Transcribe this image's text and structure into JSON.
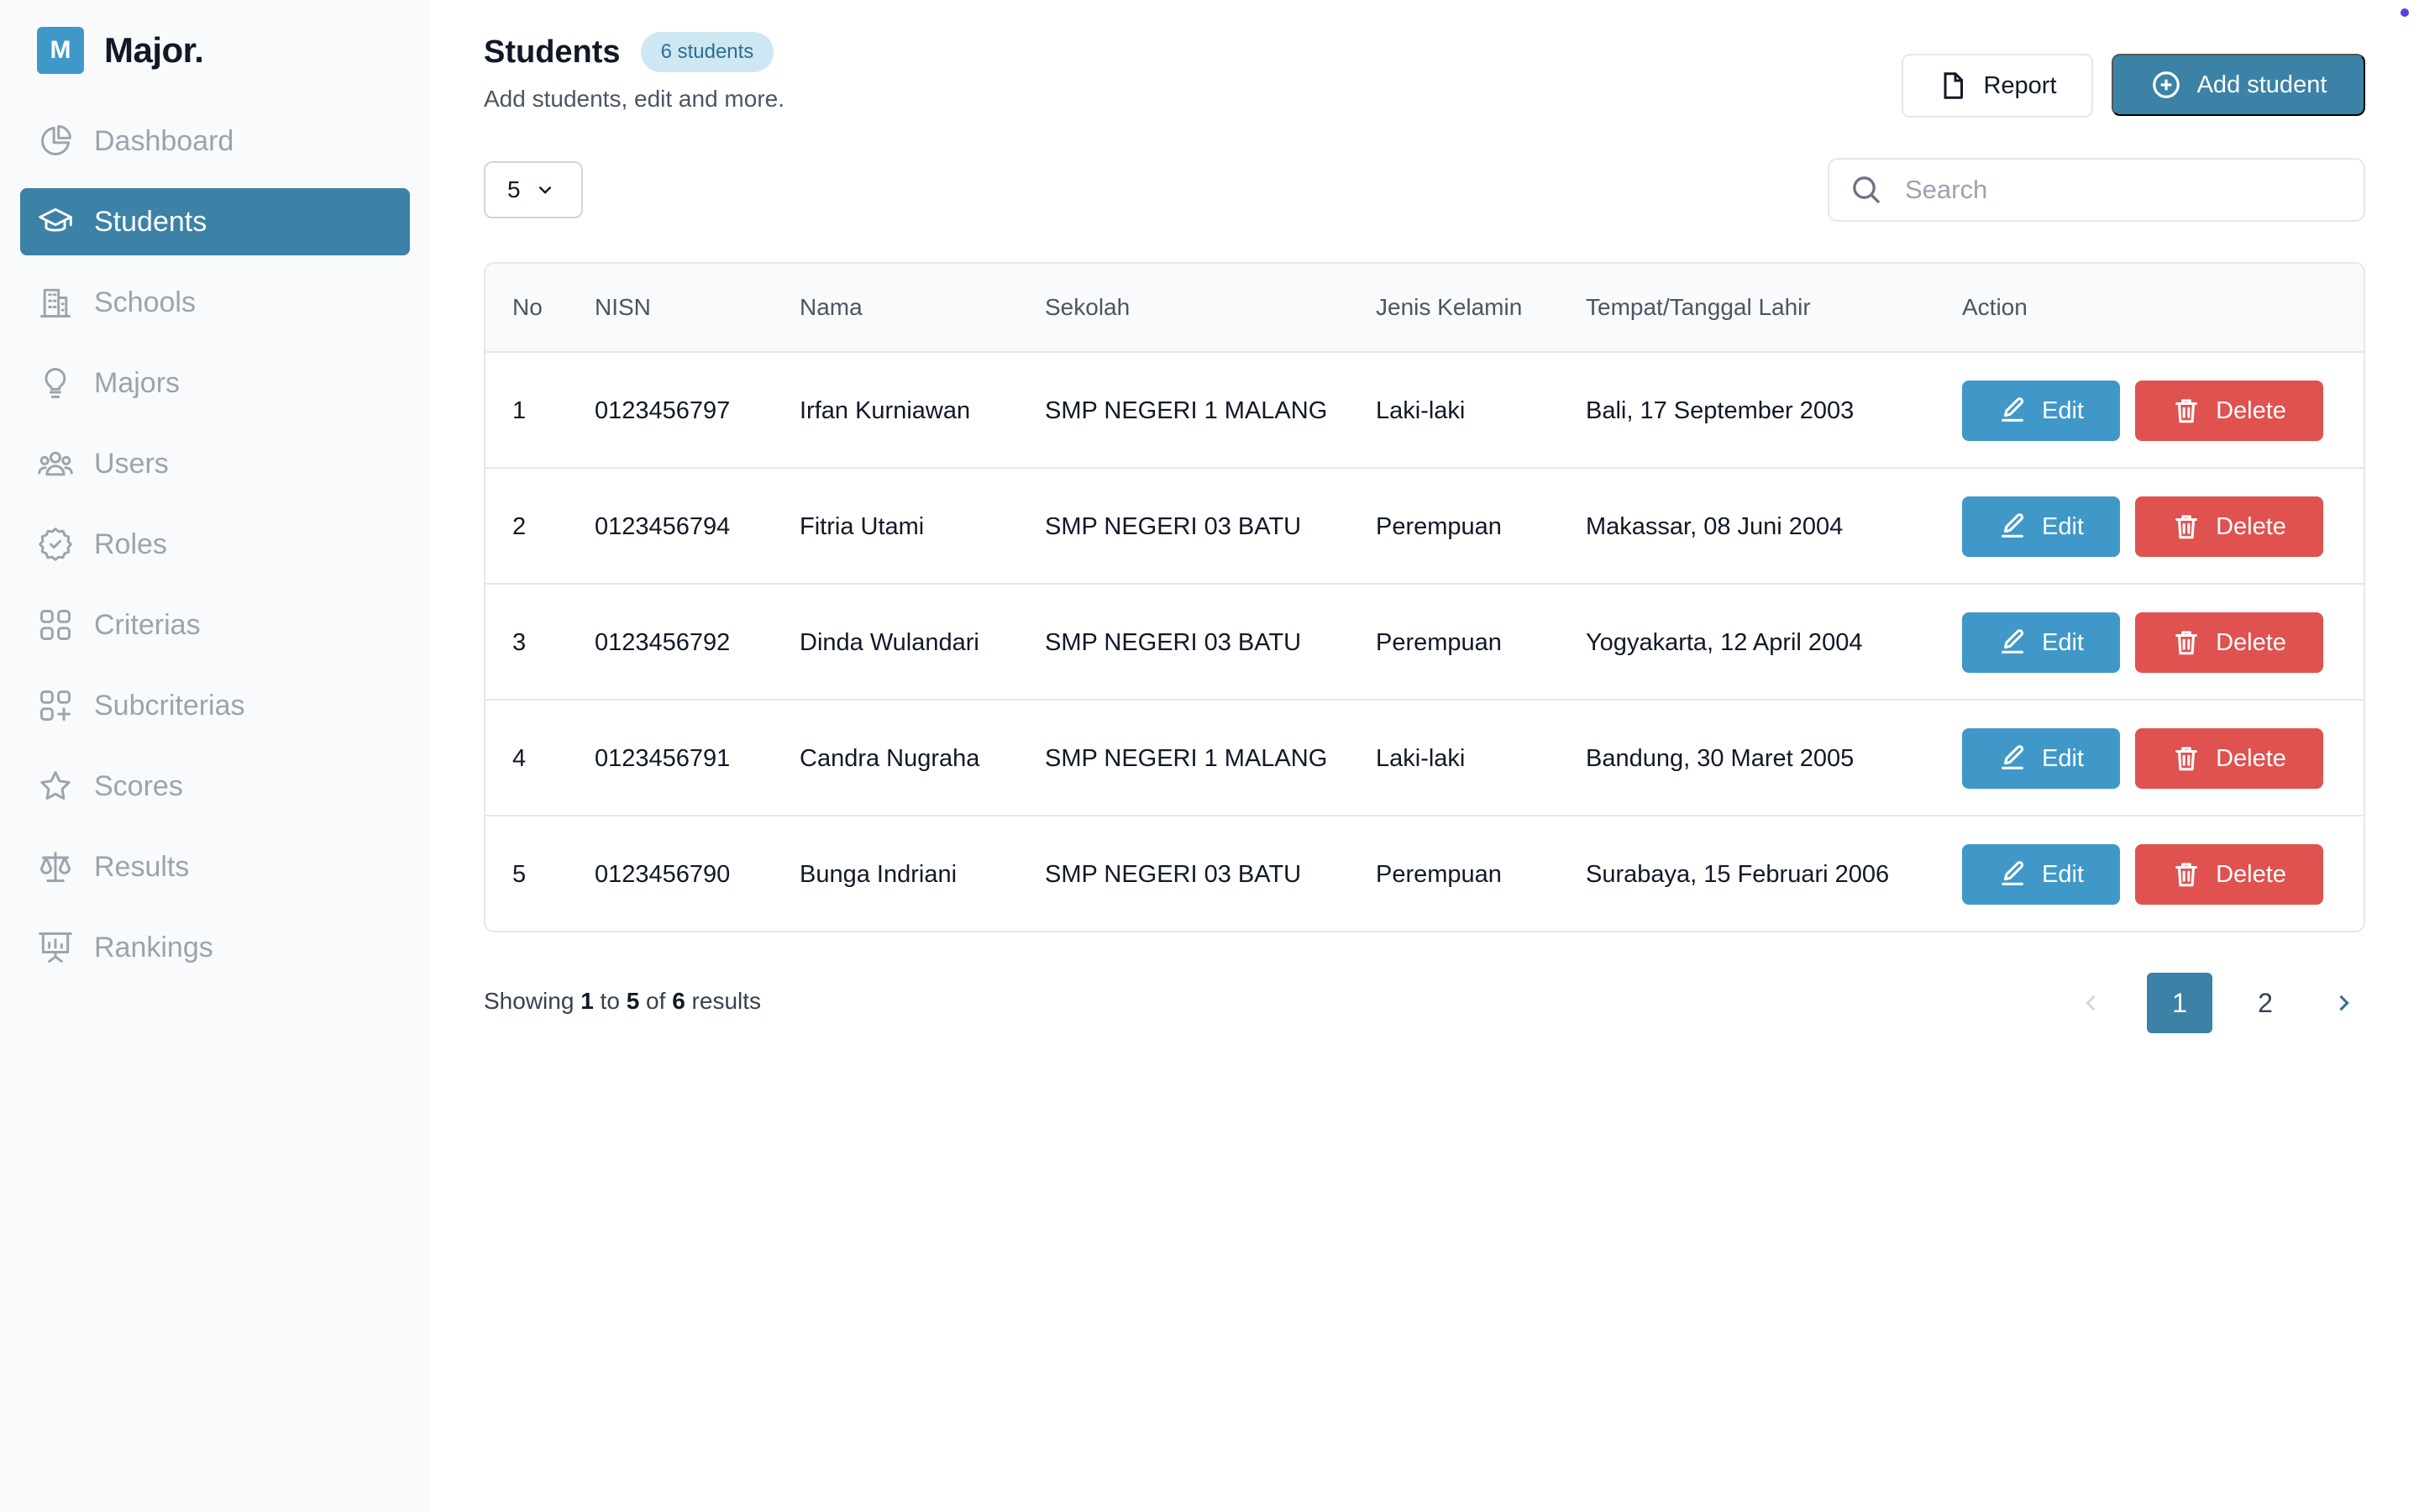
{
  "brand": {
    "mark": "M",
    "name": "Major."
  },
  "sidebar": {
    "items": [
      {
        "label": "Dashboard",
        "icon": "pie-chart-icon",
        "active": false
      },
      {
        "label": "Students",
        "icon": "graduation-cap-icon",
        "active": true
      },
      {
        "label": "Schools",
        "icon": "building-icon",
        "active": false
      },
      {
        "label": "Majors",
        "icon": "lightbulb-icon",
        "active": false
      },
      {
        "label": "Users",
        "icon": "users-icon",
        "active": false
      },
      {
        "label": "Roles",
        "icon": "cog-badge-icon",
        "active": false
      },
      {
        "label": "Criterias",
        "icon": "squares-icon",
        "active": false
      },
      {
        "label": "Subcriterias",
        "icon": "squares-plus-icon",
        "active": false
      },
      {
        "label": "Scores",
        "icon": "star-icon",
        "active": false
      },
      {
        "label": "Results",
        "icon": "scale-icon",
        "active": false
      },
      {
        "label": "Rankings",
        "icon": "presentation-chart-icon",
        "active": false
      }
    ]
  },
  "header": {
    "title": "Students",
    "badge": "6 students",
    "subtitle": "Add students, edit and more."
  },
  "toolbar": {
    "report_label": "Report",
    "add_label": "Add student",
    "per_page": "5",
    "search_placeholder": "Search"
  },
  "table": {
    "columns": [
      "No",
      "NISN",
      "Nama",
      "Sekolah",
      "Jenis Kelamin",
      "Tempat/Tanggal Lahir",
      "Action"
    ],
    "edit_label": "Edit",
    "delete_label": "Delete",
    "rows": [
      {
        "no": "1",
        "nisn": "0123456797",
        "nama": "Irfan Kurniawan",
        "sekolah": "SMP NEGERI 1 MALANG",
        "jk": "Laki-laki",
        "ttl": "Bali, 17 September 2003"
      },
      {
        "no": "2",
        "nisn": "0123456794",
        "nama": "Fitria Utami",
        "sekolah": "SMP NEGERI 03 BATU",
        "jk": "Perempuan",
        "ttl": "Makassar, 08 Juni 2004"
      },
      {
        "no": "3",
        "nisn": "0123456792",
        "nama": "Dinda Wulandari",
        "sekolah": "SMP NEGERI 03 BATU",
        "jk": "Perempuan",
        "ttl": "Yogyakarta, 12 April 2004"
      },
      {
        "no": "4",
        "nisn": "0123456791",
        "nama": "Candra Nugraha",
        "sekolah": "SMP NEGERI 1 MALANG",
        "jk": "Laki-laki",
        "ttl": "Bandung, 30 Maret 2005"
      },
      {
        "no": "5",
        "nisn": "0123456790",
        "nama": "Bunga Indriani",
        "sekolah": "SMP NEGERI 03 BATU",
        "jk": "Perempuan",
        "ttl": "Surabaya, 15 Februari 2006"
      }
    ]
  },
  "footer": {
    "showing_prefix": "Showing",
    "from": "1",
    "to_word": "to",
    "to": "5",
    "of_word": "of",
    "total": "6",
    "suffix": "results",
    "pages": [
      "1",
      "2"
    ],
    "current_page": "1"
  },
  "colors": {
    "primary": "#3b82a6",
    "edit": "#3f98c8",
    "delete": "#e0524f",
    "sidebar_bg": "#f8fafc",
    "badge_bg": "#cde7f3"
  }
}
